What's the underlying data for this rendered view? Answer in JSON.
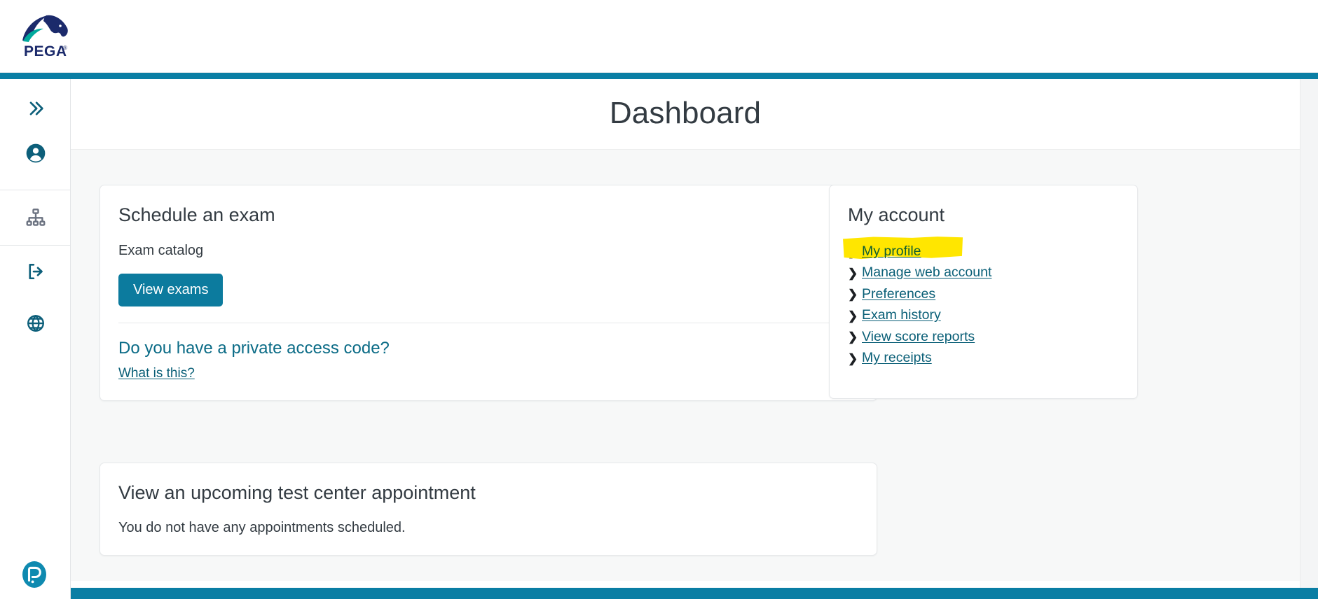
{
  "brand": {
    "logo_name": "pega-logo",
    "logo_wordmark": "PEGA",
    "footer_logo_name": "pearson-logo",
    "accent_teal": "#0a7ea4",
    "button_teal": "#0c7b9e",
    "link_teal": "#0a5f77",
    "highlight_yellow": "#ffe600"
  },
  "sidebar": {
    "items": [
      {
        "name": "expand-sidebar-button",
        "icon": "double-chevron-right-icon",
        "color": "#0d5f7a"
      },
      {
        "name": "account-button",
        "icon": "person-circle-icon",
        "color": "#0d5f7a"
      },
      {
        "name": "organization-button",
        "icon": "sitemap-icon",
        "color": "#6b7280"
      },
      {
        "name": "sign-out-button",
        "icon": "sign-out-icon",
        "color": "#0d5f7a"
      },
      {
        "name": "language-button",
        "icon": "globe-icon",
        "color": "#0d5f7a"
      }
    ]
  },
  "page": {
    "title": "Dashboard"
  },
  "schedule_card": {
    "heading": "Schedule an exam",
    "subheading": "Exam catalog",
    "button_label": "View exams",
    "accordion": {
      "title": "Do you have a private access code?",
      "link_label": "What is this?",
      "chevron_icon": "chevron-down-icon"
    }
  },
  "appointment_card": {
    "heading": "View an upcoming test center appointment",
    "body": "You do not have any appointments scheduled."
  },
  "my_account_card": {
    "heading": "My account",
    "links": [
      {
        "label": "My profile",
        "highlighted": true
      },
      {
        "label": "Manage web account",
        "highlighted": false
      },
      {
        "label": "Preferences",
        "highlighted": false
      },
      {
        "label": "Exam history",
        "highlighted": false
      },
      {
        "label": "View score reports",
        "highlighted": false
      },
      {
        "label": "My receipts",
        "highlighted": false
      }
    ]
  }
}
